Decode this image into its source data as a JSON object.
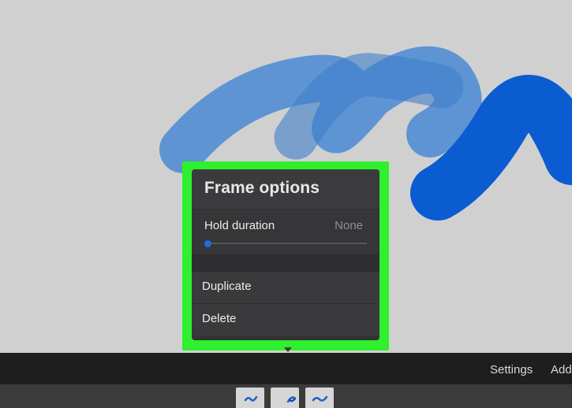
{
  "popover": {
    "title": "Frame options",
    "hold_duration_label": "Hold duration",
    "hold_duration_value": "None",
    "hold_duration_level": 0,
    "menu_items": [
      "Duplicate",
      "Delete"
    ]
  },
  "toolbar": {
    "settings_label": "Settings",
    "add_frame_label": "Add"
  },
  "frames_strip": {
    "frame_count": 3
  },
  "colors": {
    "highlight": "#2ef02e",
    "canvas_background": "#d0d0d0",
    "stroke_light_blue": "#4a8ad4",
    "stroke_dark_blue": "#0a5cd0",
    "slider_accent": "#1a6fe0",
    "panel_background": "#333335"
  },
  "icons": {
    "frame_thumb": "squiggle-stroke-icon"
  }
}
